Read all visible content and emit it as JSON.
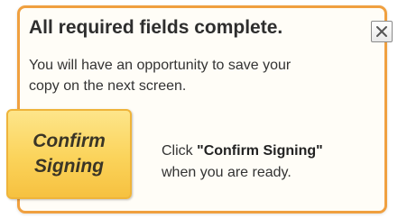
{
  "dialog": {
    "title": "All required fields complete.",
    "close_icon": "close-icon",
    "message_line1": "You will have an opportunity to save your",
    "message_line2": "copy on the next screen.",
    "confirm_button": {
      "line1": "Confirm",
      "line2": "Signing"
    },
    "hint": {
      "prefix": "Click ",
      "emphasis": "\"Confirm Signing\"",
      "suffix": "when you are ready."
    }
  },
  "colors": {
    "border": "#f0a040",
    "button_fill": "#fbd35a",
    "button_border": "#efb43a",
    "text": "#333333"
  }
}
